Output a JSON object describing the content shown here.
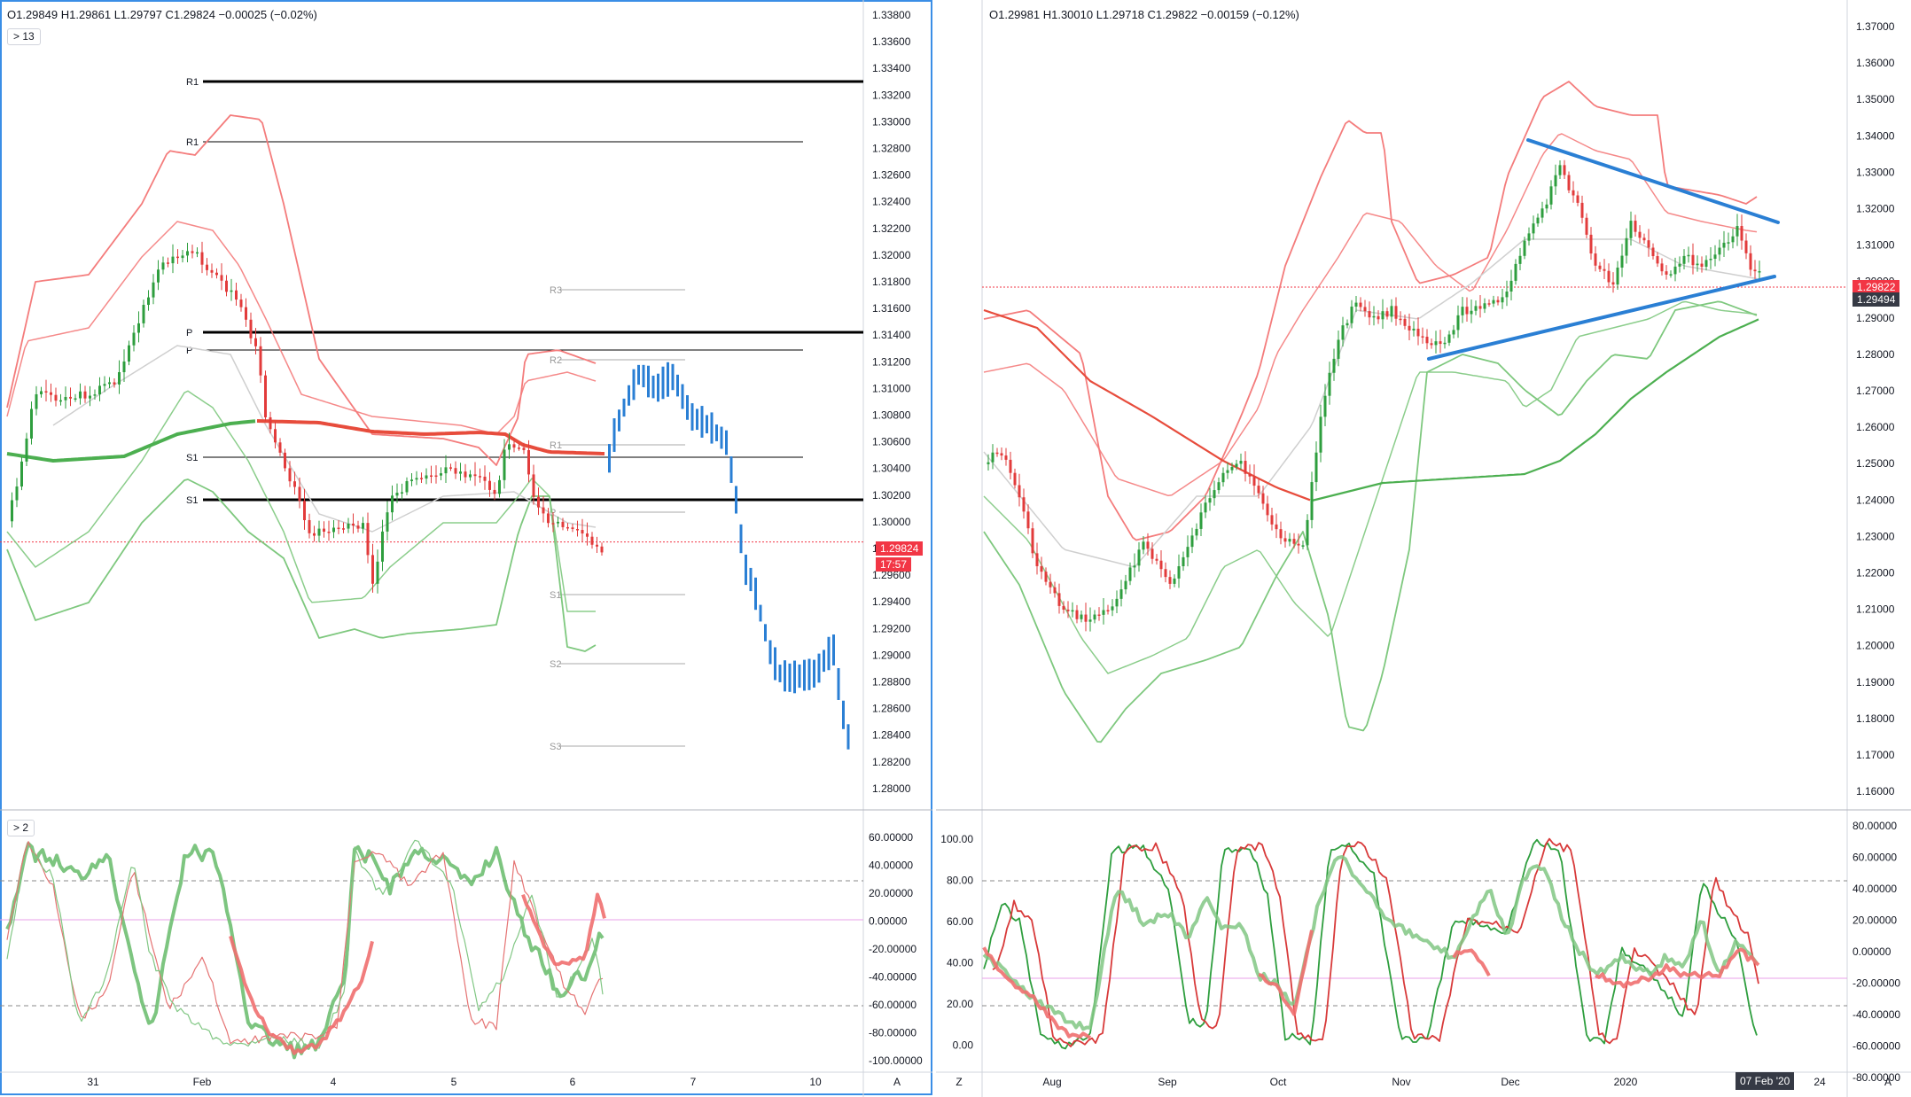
{
  "colors": {
    "up": "#26a69a",
    "down": "#ef5350",
    "bb_upper": "#f47c7c",
    "bb_lower": "#7ec87e",
    "sma_red": "#e74c3c",
    "sma_green": "#4caf50",
    "trendline": "#2a7fd4",
    "projection": "#2a7fd4",
    "price_badge": "#f23645",
    "pane_border": "#3a8ee6"
  },
  "left_chart": {
    "ohlc": "O1.29849  H1.29861  L1.29797  C1.29824  −0.00025 (−0.02%)",
    "collapse_label": "> 13",
    "price_badge": "1.29824",
    "countdown": "17:57",
    "pivot_labels": [
      "R1",
      "R1",
      "P",
      "P",
      "S1",
      "S1",
      "R3",
      "R2",
      "R1",
      "P",
      "S1",
      "S2",
      "S3"
    ],
    "y_ticks": [
      "1.33800",
      "1.33600",
      "1.33400",
      "1.33200",
      "1.33000",
      "1.32800",
      "1.32600",
      "1.32400",
      "1.32200",
      "1.32000",
      "1.31800",
      "1.31600",
      "1.31400",
      "1.31200",
      "1.31000",
      "1.30800",
      "1.30600",
      "1.30400",
      "1.30200",
      "1.30000",
      "1.29800",
      "1.29600",
      "1.29400",
      "1.29200",
      "1.29000",
      "1.28800",
      "1.28600",
      "1.28400",
      "1.28200",
      "1.28000"
    ],
    "x_ticks": [
      "31",
      "Feb",
      "4",
      "5",
      "6",
      "7",
      "10"
    ],
    "axis_corner": "A"
  },
  "left_osc": {
    "collapse_label": "> 2",
    "y_ticks": [
      "60.00000",
      "40.00000",
      "20.00000",
      "0.00000",
      "-20.00000",
      "-40.00000",
      "-60.00000",
      "-80.00000",
      "-100.00000"
    ]
  },
  "right_chart": {
    "ohlc": "O1.29981  H1.30010  L1.29718  C1.29822  −0.00159 (−0.12%)",
    "price_badge_top": "1.29822",
    "price_badge_bottom": "1.29494",
    "y_ticks": [
      "1.37000",
      "1.36000",
      "1.35000",
      "1.34000",
      "1.33000",
      "1.32000",
      "1.31000",
      "1.30000",
      "1.29000",
      "1.28000",
      "1.27000",
      "1.26000",
      "1.25000",
      "1.24000",
      "1.23000",
      "1.22000",
      "1.21000",
      "1.20000",
      "1.19000",
      "1.18000",
      "1.17000",
      "1.16000"
    ],
    "x_ticks": [
      "Aug",
      "Sep",
      "Oct",
      "Nov",
      "Dec",
      "2020",
      "24"
    ],
    "date_badge": "07 Feb '20",
    "axis_corner_left": "Z",
    "axis_corner_right": "A"
  },
  "right_osc": {
    "left_ticks": [
      "100.00",
      "80.00",
      "60.00",
      "40.00",
      "20.00",
      "0.00"
    ],
    "right_ticks": [
      "80.00000",
      "60.00000",
      "40.00000",
      "20.00000",
      "0.00000",
      "-20.00000",
      "-40.00000",
      "-60.00000",
      "-80.00000"
    ]
  },
  "chart_data": [
    {
      "type": "candlestick",
      "title": "",
      "ylim": [
        1.278,
        1.339
      ],
      "series": [
        {
          "name": "",
          "values": [
            1.2982
          ]
        }
      ]
    },
    {
      "type": "candlestick",
      "title": "",
      "ylim": [
        1.155,
        1.375
      ],
      "series": [
        {
          "name": "",
          "values": [
            1.29822
          ]
        }
      ]
    }
  ]
}
